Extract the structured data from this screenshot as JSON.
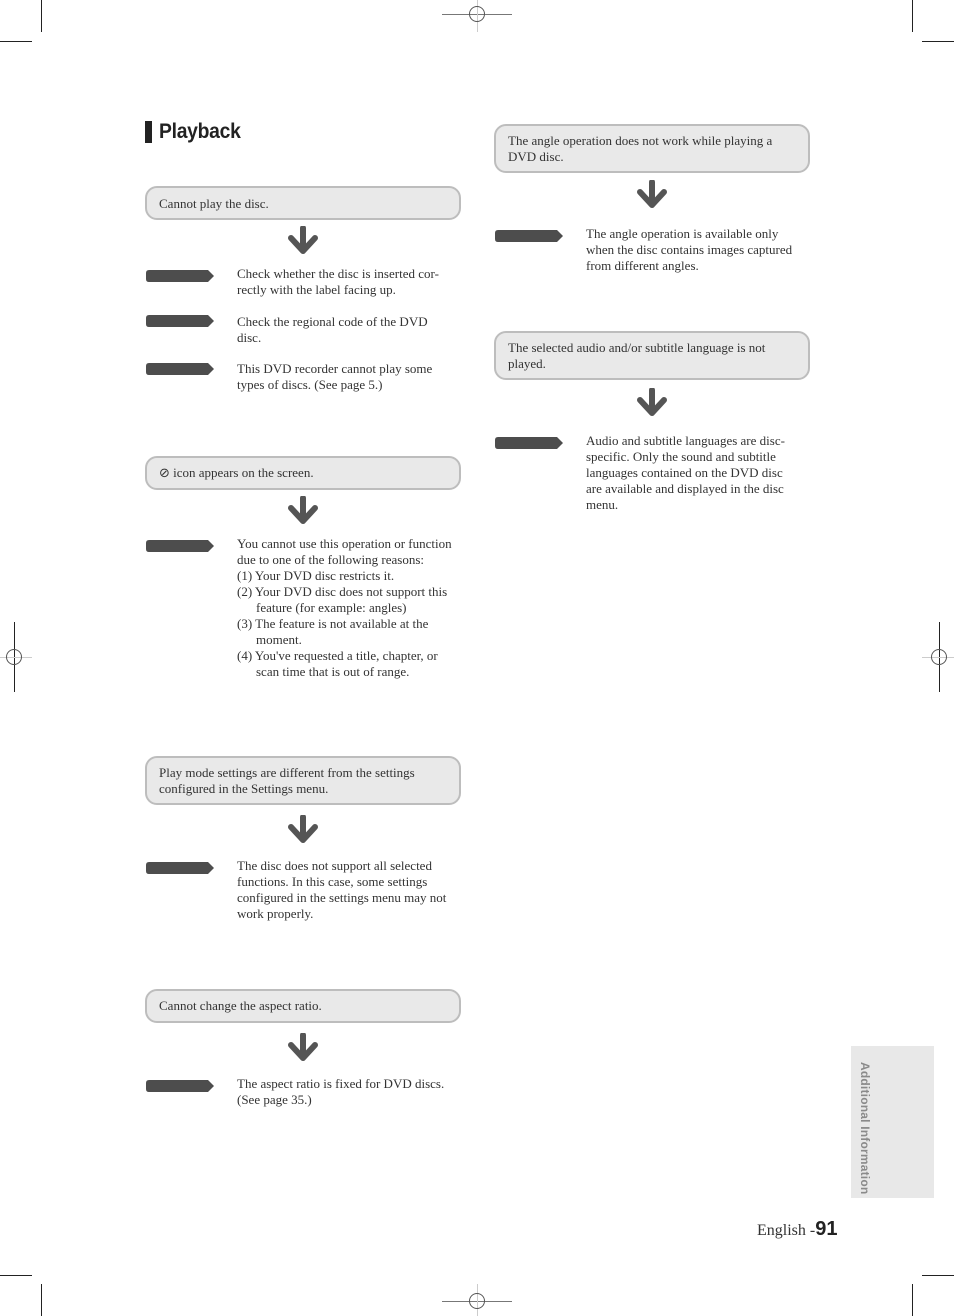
{
  "page": {
    "heading": "Playback",
    "side_tab_label": "Additional Information",
    "footer": {
      "language": "English -",
      "page_number": "91"
    }
  },
  "colors": {
    "symptom_bg": "#e9e9e9",
    "symptom_border": "#bdbdbd",
    "arrow": "#555555",
    "tag": "#4d4d4d",
    "side_tab_bg": "#e8e8e8"
  },
  "icons": {
    "down_arrow": "down-arrow-icon",
    "answer_tag": "pointer-tag-icon",
    "prohibited": "prohibited-icon"
  },
  "left_column": [
    {
      "symptom": "Cannot play the disc.",
      "answers": [
        "Check whether the disc is inserted cor-\nrectly with the label facing up.",
        "Check the regional code of the DVD\ndisc.",
        "This DVD recorder cannot play some\ntypes of discs. (See page 5.)"
      ]
    },
    {
      "symptom_icon": "⊘",
      "symptom": "icon appears on the screen.",
      "answers": [
        {
          "intro": "You cannot use this operation or function due to one of the following reasons:",
          "reasons": [
            "(1) Your DVD disc restricts it.",
            "(2) Your DVD disc does not support this feature (for example: angles)",
            "(3) The feature is not available at the moment.",
            "(4) You've requested a title, chapter, or scan time that is out of range."
          ]
        }
      ]
    },
    {
      "symptom": "Play mode settings are different from the settings configured in the Settings menu.",
      "answers": [
        "The disc does not support all selected functions. In this case, some settings configured in the settings menu may not work properly."
      ]
    },
    {
      "symptom": "Cannot change the aspect ratio.",
      "answers": [
        "The aspect ratio is fixed for DVD discs. (See page 35.)"
      ]
    }
  ],
  "right_column": [
    {
      "symptom": "The angle operation does not work while playing a DVD disc.",
      "answers": [
        "The angle operation is available only when the disc contains images captured from different angles."
      ]
    },
    {
      "symptom": "The selected audio and/or subtitle language is not played.",
      "answers": [
        "Audio and subtitle languages are disc-specific. Only the sound and subtitle languages contained on the DVD disc are available and displayed in the disc menu."
      ]
    }
  ]
}
